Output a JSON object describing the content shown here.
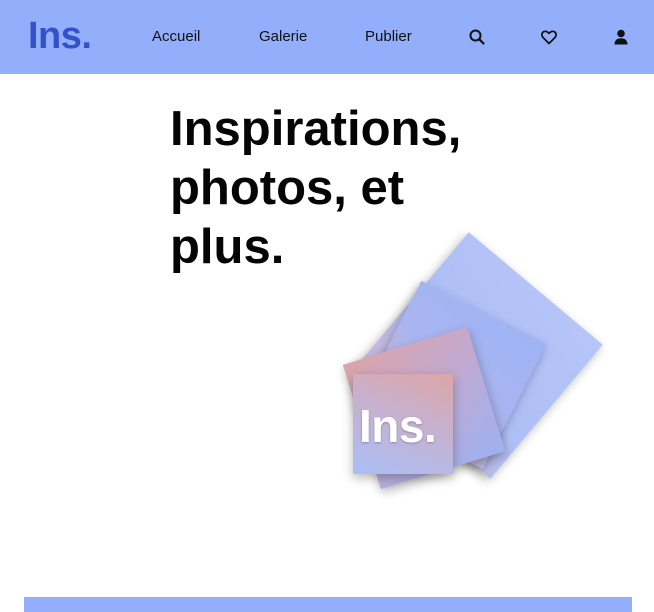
{
  "header": {
    "logo": "Ins.",
    "nav": {
      "home": "Accueil",
      "gallery": "Galerie",
      "publish": "Publier"
    },
    "icons": {
      "search": "search-icon",
      "favorites": "heart-icon",
      "account": "user-icon"
    }
  },
  "hero": {
    "title": "Inspirations, photos, et plus.",
    "card_logo": "Ins."
  },
  "colors": {
    "header_bg": "#93aefa",
    "logo": "#3452c7",
    "footer_bar": "#93aefa"
  }
}
